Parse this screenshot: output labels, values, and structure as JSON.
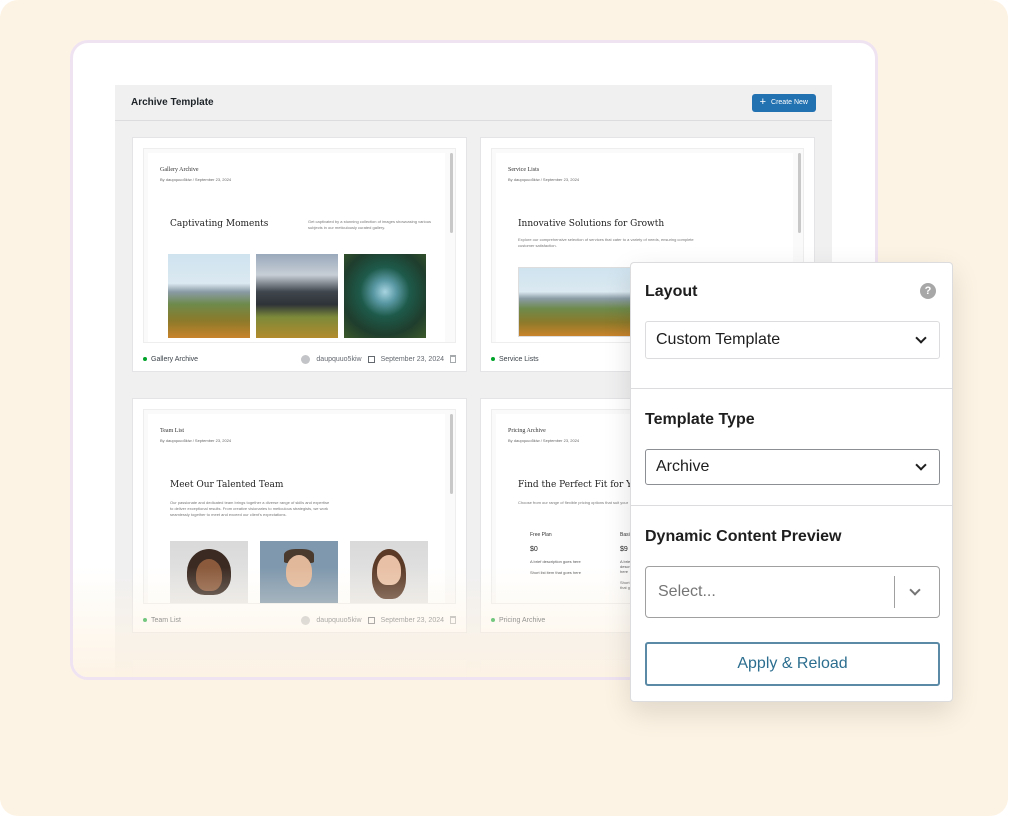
{
  "app": {
    "title": "Archive Template",
    "create_button": "Create New"
  },
  "cards": [
    {
      "doc_title": "Gallery Archive",
      "doc_meta": "By daupquuo5kiw / September 23, 2024",
      "heading": "Captivating Moments",
      "desc": "Get captivated by a stunning collection of images showcasing various subjects in our meticulously curated gallery.",
      "footer_name": "Gallery Archive",
      "author": "daupquuo5kiw",
      "date": "September 23, 2024"
    },
    {
      "doc_title": "Service Lists",
      "doc_meta": "By daupquuo5kiw / September 23, 2024",
      "heading": "Innovative Solutions for Growth",
      "desc": "Explore our comprehensive selection of services that cater to a variety of needs, ensuring complete customer satisfaction.",
      "footer_name": "Service Lists"
    },
    {
      "doc_title": "Team List",
      "doc_meta": "By daupquuo5kiw / September 23, 2024",
      "heading": "Meet Our Talented Team",
      "desc": "Our passionate and dedicated team brings together a diverse range of skills and expertise to deliver exceptional results. From creative visionaries to meticulous strategists, we work seamlessly together to meet and exceed our client's expectations.",
      "footer_name": "Team List",
      "author": "daupquuo5kiw",
      "date": "September 23, 2024"
    },
    {
      "doc_title": "Pricing Archive",
      "doc_meta": "By daupquuo5kiw / September 23, 2024",
      "heading": "Find the Perfect Fit for Your",
      "desc": "Choose from our range of flexible pricing options that suit your",
      "footer_name": "Pricing Archive",
      "plan1_name": "Free Plan",
      "plan1_price": "$0",
      "plan1_desc": "A brief description goes here",
      "plan1_feature": "Short list item that goes here",
      "plan2_name": "Basic",
      "plan2_price": "$9",
      "plan2_desc": "A brief description goes here",
      "plan2_feature": "Short list item that goes here"
    }
  ],
  "panel": {
    "layout_label": "Layout",
    "layout_value": "Custom Template",
    "template_type_label": "Template Type",
    "template_type_value": "Archive",
    "dynamic_label": "Dynamic Content Preview",
    "dynamic_placeholder": "Select...",
    "apply_button": "Apply & Reload"
  },
  "colors": {
    "background": "#fdf3e4",
    "primary_button": "#2271b1",
    "apply_border": "#5b8aa6",
    "status_dot": "#00a32a"
  }
}
